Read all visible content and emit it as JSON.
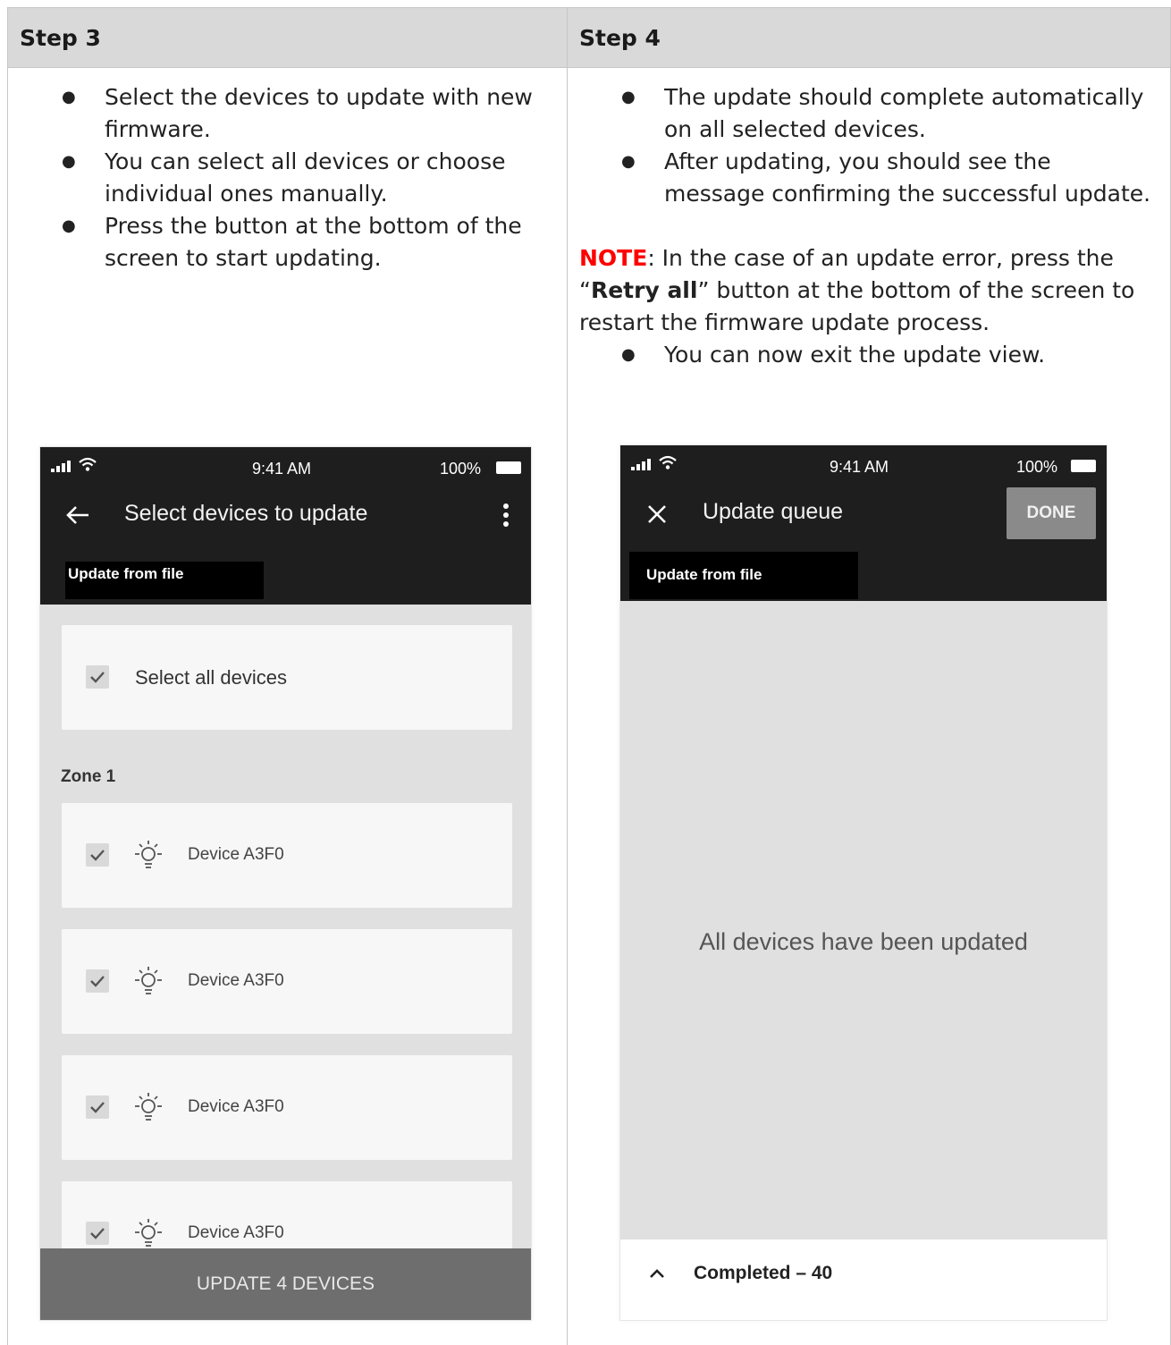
{
  "headers": {
    "step3": "Step 3",
    "step4": "Step 4"
  },
  "step3": {
    "bullets": [
      {
        "l1": "Select the devices to update with new",
        "l2": "firmware."
      },
      {
        "l1": "You can select all devices or choose",
        "l2": "individual ones manually."
      },
      {
        "l1": "Press the button at the bottom of the",
        "l2": "screen to start updating."
      }
    ]
  },
  "step4": {
    "bullets": [
      {
        "l1": "The update should complete automatically",
        "l2": "on all selected devices."
      },
      {
        "l1": "After updating, you should see the",
        "l2": "message confirming the successful update."
      }
    ],
    "note": {
      "label": "NOTE",
      "text1": ": In the case of an update error, press the",
      "quote_open": "“",
      "button": "Retry all",
      "text2": "” button at the bottom of the screen to",
      "text3": "restart the  firmware update process."
    },
    "last_bullet": "You can now exit the update view."
  },
  "phone1": {
    "time": "9:41 AM",
    "battery": "100%",
    "title": "Select devices to update",
    "tab": "Update from file",
    "select_all": "Select all devices",
    "zone": "Zone 1",
    "devices": [
      "Device  A3F0",
      "Device  A3F0",
      "Device  A3F0",
      "Device  A3F0"
    ],
    "button": "UPDATE 4 DEVICES",
    "icons": {
      "back": "arrow-left-icon",
      "menu": "more-vert-icon",
      "check": "check-icon",
      "bulb": "lightbulb-icon"
    }
  },
  "phone2": {
    "time": "9:41 AM",
    "battery": "100%",
    "title": "Update queue",
    "done": "DONE",
    "tab": "Update from file",
    "message": "All devices have been updated",
    "completed": "Completed – 40",
    "icons": {
      "close": "close-icon",
      "expand": "chevron-up-icon"
    }
  }
}
